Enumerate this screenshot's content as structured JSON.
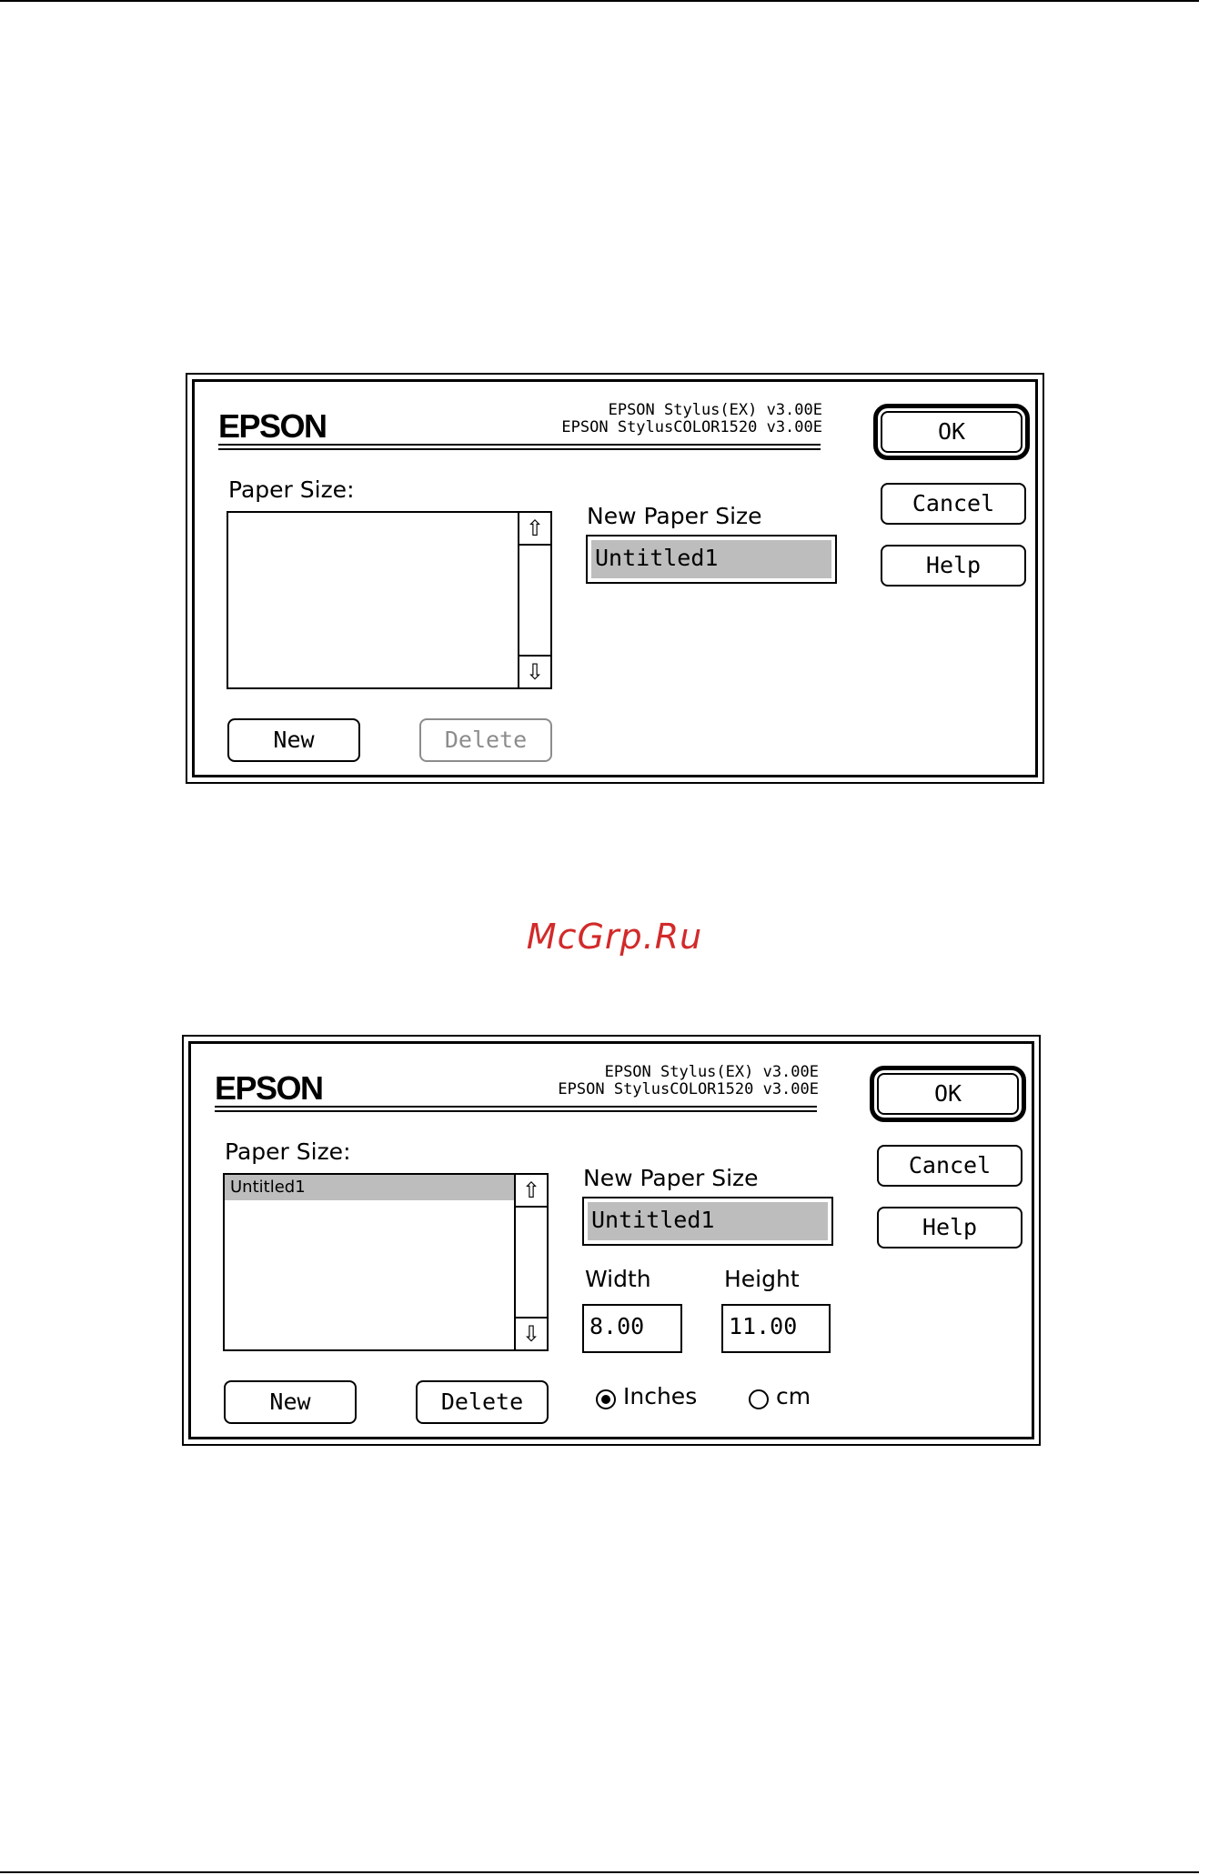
{
  "watermark": "McGrp.Ru",
  "dialog1": {
    "logo": "EPSON",
    "version_line1": "EPSON Stylus(EX) v3.00E",
    "version_line2": "EPSON StylusCOLOR1520 v3.00E",
    "paper_size_label": "Paper Size:",
    "paper_size_items": [],
    "new_paper_size_label": "New Paper Size",
    "new_paper_size_value": "Untitled1",
    "buttons": {
      "ok": "OK",
      "cancel": "Cancel",
      "help": "Help",
      "new": "New",
      "delete": "Delete"
    },
    "delete_enabled": false
  },
  "dialog2": {
    "logo": "EPSON",
    "version_line1": "EPSON Stylus(EX) v3.00E",
    "version_line2": "EPSON StylusCOLOR1520 v3.00E",
    "paper_size_label": "Paper Size:",
    "paper_size_items": [
      "Untitled1"
    ],
    "selected_item": "Untitled1",
    "new_paper_size_label": "New Paper Size",
    "new_paper_size_value": "Untitled1",
    "width_label": "Width",
    "width_value": "8.00",
    "height_label": "Height",
    "height_value": "11.00",
    "units": {
      "inches": "Inches",
      "cm": "cm",
      "selected": "Inches"
    },
    "buttons": {
      "ok": "OK",
      "cancel": "Cancel",
      "help": "Help",
      "new": "New",
      "delete": "Delete"
    },
    "delete_enabled": true
  },
  "icons": {
    "scroll_up": "arrow-up-outline-icon",
    "scroll_down": "arrow-down-outline-icon"
  },
  "colors": {
    "watermark": "#d22a2a",
    "selection": "#bdbdbd",
    "disabled": "#8c8c8c"
  }
}
